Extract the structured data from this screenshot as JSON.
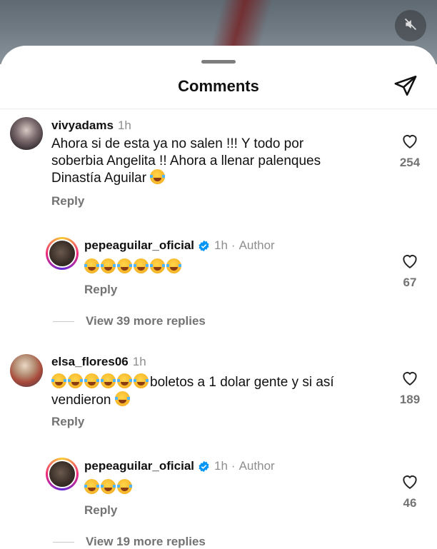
{
  "header": {
    "title": "Comments"
  },
  "comments": [
    {
      "username": "vivyadams",
      "time": "1h",
      "lines": [
        "Ahora si de esta ya no salen !!! Y todo por",
        "soberbia Angelita !! Ahora a llenar palenques",
        "Dinastía Aguilar"
      ],
      "emoji_count": 1,
      "reply_label": "Reply",
      "likes": "254",
      "reply": {
        "username": "pepeaguilar_oficial",
        "verified": true,
        "time": "1h",
        "separator": "·",
        "author_label": "Author",
        "emoji_count": 6,
        "reply_label": "Reply",
        "likes": "67"
      },
      "view_more": "View 39 more replies"
    },
    {
      "username": "elsa_flores06",
      "time": "1h",
      "lines": [
        "boletos a 1 dolar gente y si así",
        "vendieron"
      ],
      "leading_emoji_count": 6,
      "emoji_count": 1,
      "reply_label": "Reply",
      "likes": "189",
      "reply": {
        "username": "pepeaguilar_oficial",
        "verified": true,
        "time": "1h",
        "separator": "·",
        "author_label": "Author",
        "emoji_count": 3,
        "reply_label": "Reply",
        "likes": "46"
      },
      "view_more": "View 19 more replies"
    }
  ],
  "icons": {
    "mute": "speaker-muted-icon",
    "share": "paper-plane-icon",
    "like": "heart-outline-icon",
    "verified": "verified-badge-icon",
    "emoji": "tears-of-joy-emoji"
  },
  "colors": {
    "verified": "#0095f6",
    "muted_text": "#737373"
  }
}
